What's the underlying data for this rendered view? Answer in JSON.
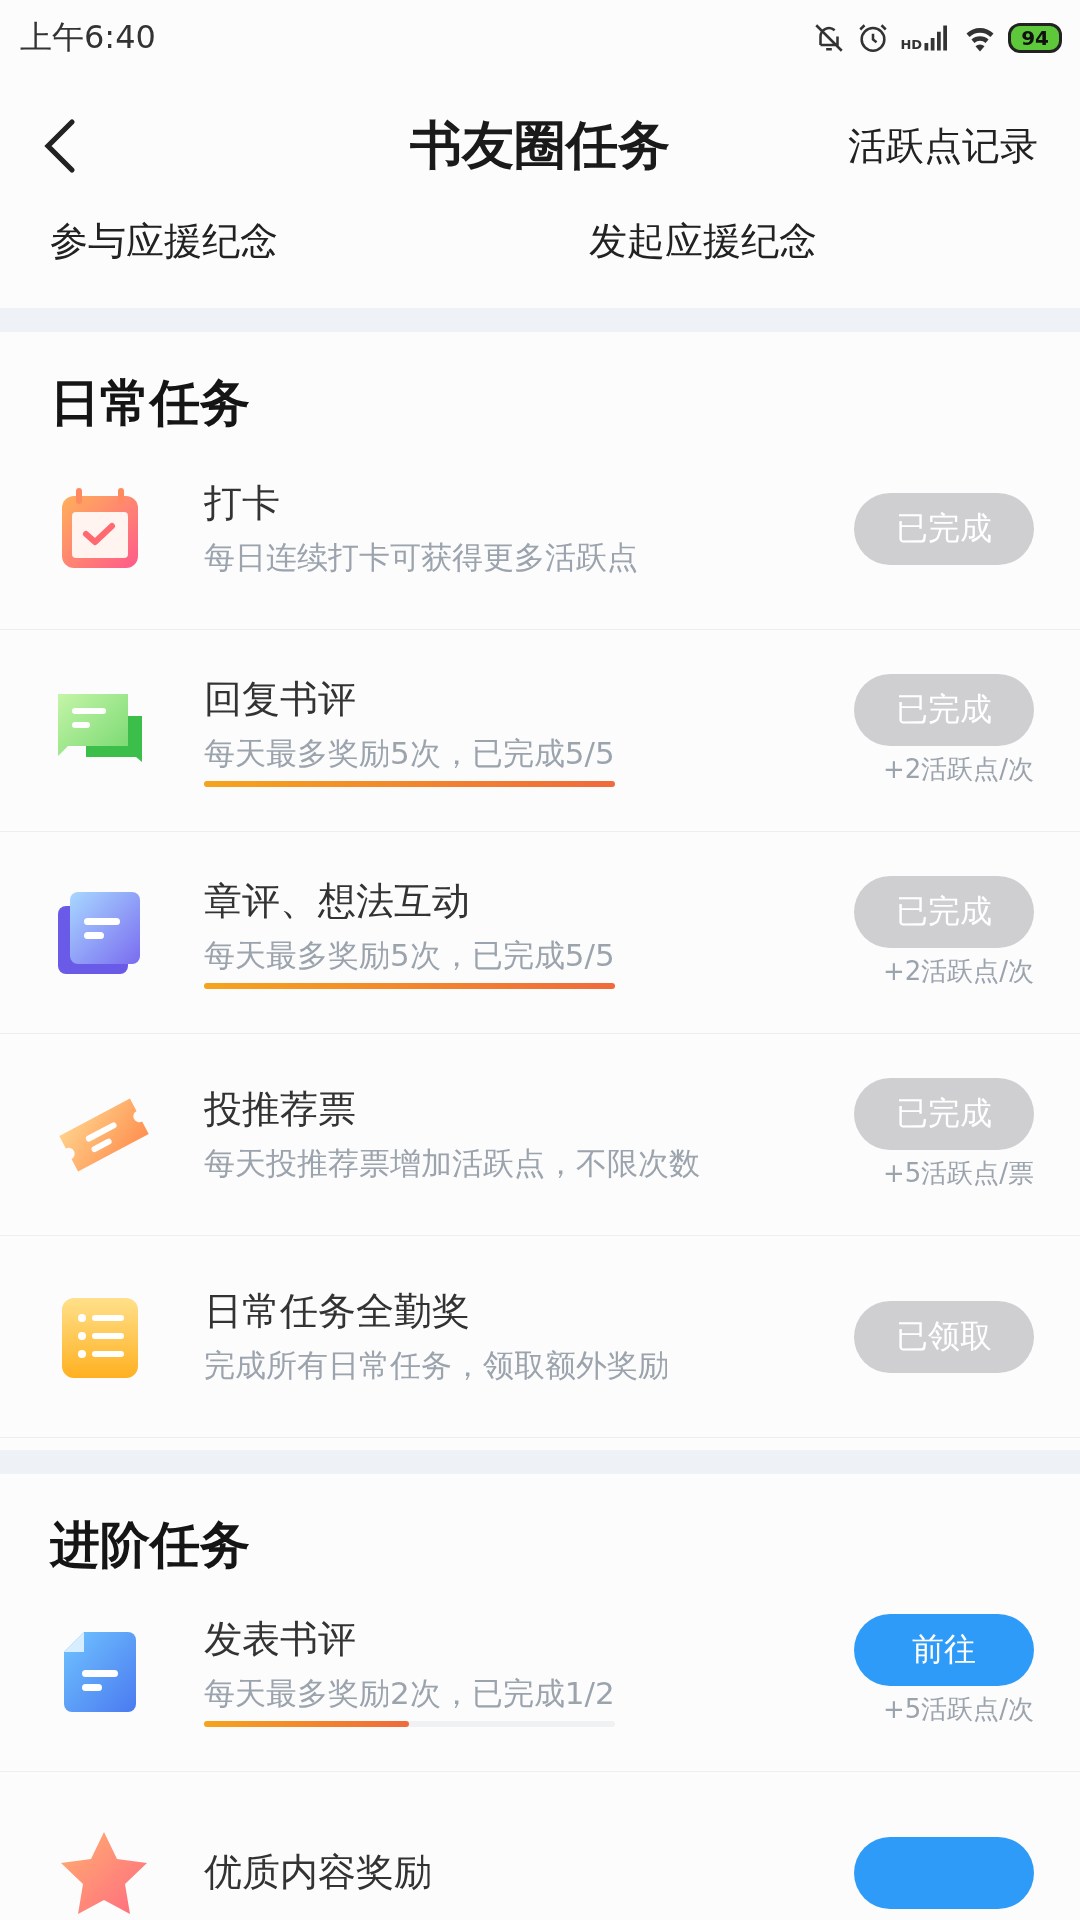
{
  "status_bar": {
    "time": "上午6:40",
    "network_label": "HD",
    "battery": "94"
  },
  "header": {
    "title": "书友圈任务",
    "action": "活跃点记录"
  },
  "tabs": [
    {
      "label": "参与应援纪念"
    },
    {
      "label": "发起应援纪念"
    }
  ],
  "sections": [
    {
      "title": "日常任务",
      "tasks": [
        {
          "kind": "calendar",
          "title": "打卡",
          "subtitle": "每日连续打卡可获得更多活跃点",
          "button": {
            "kind": "done",
            "label": "已完成"
          }
        },
        {
          "kind": "chat",
          "title": "回复书评",
          "subtitle": "每天最多奖励5次，已完成5/5",
          "level": 1,
          "button": {
            "kind": "done",
            "label": "已完成"
          },
          "reward": "+2活跃点/次"
        },
        {
          "kind": "cards",
          "title": "章评、想法互动",
          "subtitle": "每天最多奖励5次，已完成5/5",
          "level": 1,
          "button": {
            "kind": "done",
            "label": "已完成"
          },
          "reward": "+2活跃点/次"
        },
        {
          "kind": "ticket",
          "title": "投推荐票",
          "subtitle": "每天投推荐票增加活跃点，不限次数",
          "button": {
            "kind": "done",
            "label": "已完成"
          },
          "reward": "+5活跃点/票"
        },
        {
          "kind": "list",
          "title": "日常任务全勤奖",
          "subtitle": "完成所有日常任务，领取额外奖励",
          "button": {
            "kind": "done",
            "label": "已领取"
          }
        }
      ]
    },
    {
      "title": "进阶任务",
      "tasks": [
        {
          "kind": "document",
          "title": "发表书评",
          "subtitle": "每天最多奖励2次，已完成1/2",
          "level": 0.5,
          "button": {
            "kind": "go",
            "label": "前往"
          },
          "reward": "+5活跃点/次"
        },
        {
          "kind": "star",
          "title": "优质内容奖励",
          "button": {
            "kind": "go"
          }
        }
      ]
    }
  ]
}
